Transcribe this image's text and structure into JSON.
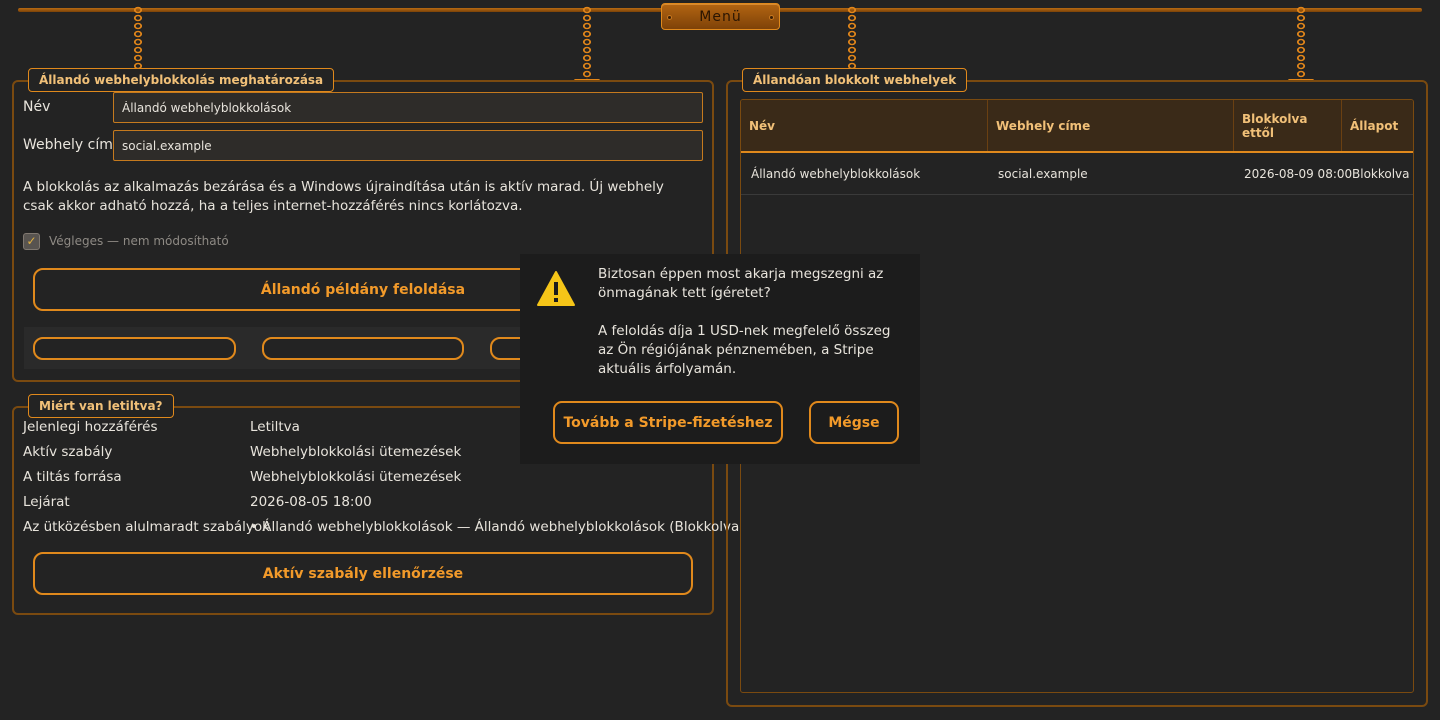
{
  "menu": {
    "label": "Menü"
  },
  "left_panel": {
    "legend": "Állandó webhelyblokkolás meghatározása",
    "name_label": "Név",
    "name_value": "Állandó webhelyblokkolások",
    "address_label": "Webhely címe",
    "address_value": "social.example",
    "info": "A blokkolás az alkalmazás bezárása és a Windows újraindítása után is aktív marad. Új webhely csak akkor adható hozzá, ha a teljes internet-hozzáférés nincs korlátozva.",
    "checkbox_label": "Végleges — nem módosítható",
    "checkbox_mark": "✓",
    "unlock_button": "Állandó példány feloldása"
  },
  "why_panel": {
    "legend": "Miért van letiltva?",
    "rows": [
      {
        "label": "Jelenlegi hozzáférés",
        "value": "Letiltva"
      },
      {
        "label": "Aktív szabály",
        "value": "Webhelyblokkolási ütemezések"
      },
      {
        "label": "A tiltás forrása",
        "value": "Webhelyblokkolási ütemezések"
      },
      {
        "label": "Lejárat",
        "value": "2026-08-05 18:00"
      },
      {
        "label": "Az ütközésben alulmaradt szabályok",
        "value": "• Állandó webhelyblokkolások — Állandó webhelyblokkolások (Blokkolva)"
      }
    ],
    "check_button": "Aktív szabály ellenőrzése"
  },
  "right_panel": {
    "legend": "Állandóan blokkolt webhelyek",
    "columns": [
      "Név",
      "Webhely címe",
      "Blokkolva ettől",
      "Állapot"
    ],
    "rows": [
      [
        "Állandó webhelyblokkolások",
        "social.example",
        "2026-08-09 08:00",
        "Blokkolva"
      ]
    ]
  },
  "dialog": {
    "question": "Biztosan éppen most akarja megszegni az önmagának tett ígéretet?",
    "detail": "A feloldás díja 1 USD-nek megfelelő összeg az Ön régiójának pénznemében, a Stripe aktuális árfolyamán.",
    "continue_button": "Tovább a Stripe-fizetéshez",
    "cancel_button": "Mégse"
  },
  "colors": {
    "accent": "#e0891c",
    "background": "#232323",
    "dialog": "#1c1c1c",
    "warning": "#f5c518"
  }
}
